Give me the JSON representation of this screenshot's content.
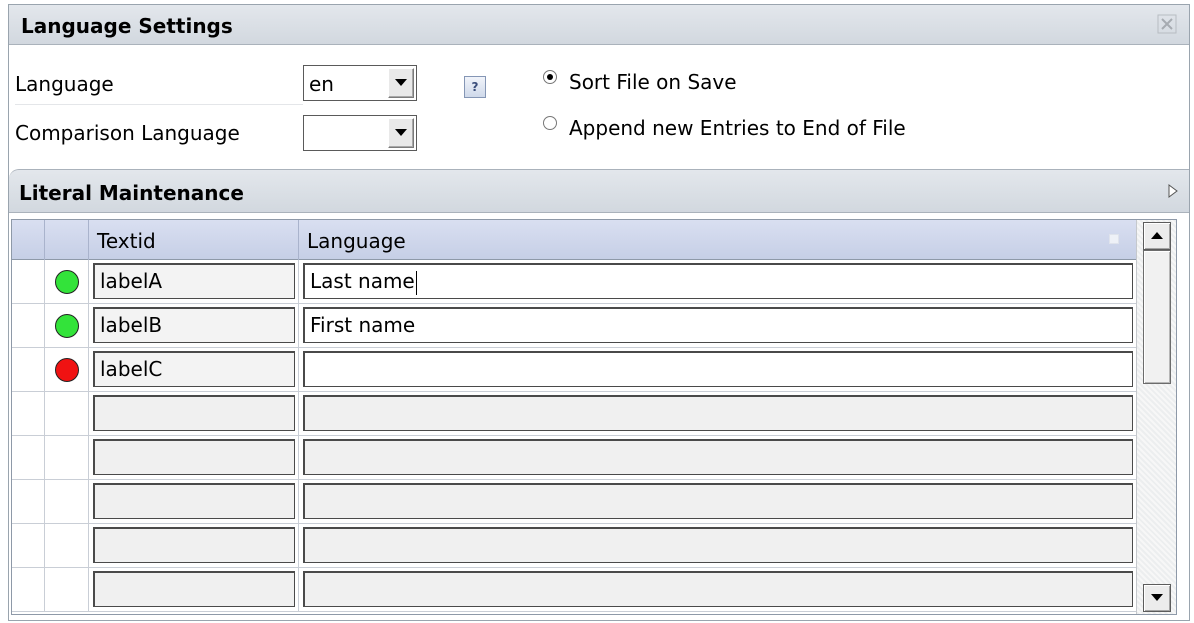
{
  "language_settings": {
    "title": "Language Settings",
    "language_label": "Language",
    "language_value": "en",
    "comparison_label": "Comparison Language",
    "comparison_value": "",
    "help_icon": "?",
    "sort_option": "Sort File on Save",
    "append_option": "Append new Entries to End of File",
    "selected_option": "sort"
  },
  "literal_maintenance": {
    "title": "Literal Maintenance",
    "columns": [
      "Textid",
      "Language"
    ],
    "rows": [
      {
        "textid": "labelA",
        "value": "Last name",
        "status": "green"
      },
      {
        "textid": "labelB",
        "value": "First name",
        "status": "green"
      },
      {
        "textid": "labelC",
        "value": "",
        "status": "red"
      },
      {
        "textid": "",
        "value": "",
        "status": ""
      },
      {
        "textid": "",
        "value": "",
        "status": ""
      },
      {
        "textid": "",
        "value": "",
        "status": ""
      },
      {
        "textid": "",
        "value": "",
        "status": ""
      },
      {
        "textid": "",
        "value": "",
        "status": ""
      }
    ]
  },
  "colors": {
    "status_green": "#33e33a",
    "status_red": "#f01212",
    "header_bg": "#d7dde4",
    "table_header_bg": "#cfd7ec"
  }
}
